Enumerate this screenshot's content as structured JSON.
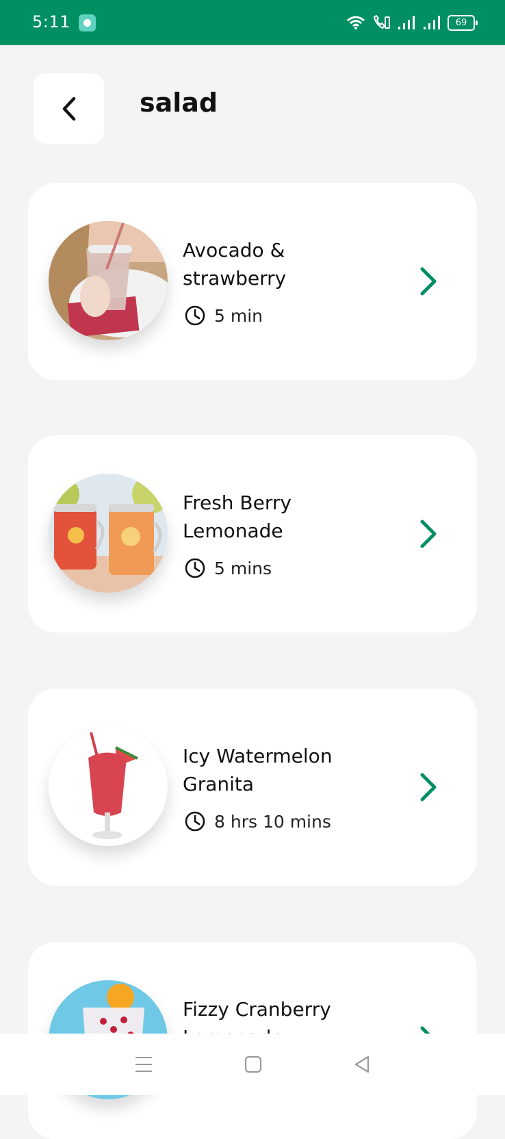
{
  "status_bar": {
    "time": "5:11",
    "battery": "69",
    "icons": [
      "app-notification-icon",
      "wifi-icon",
      "wifi-calling-icon",
      "signal-icon",
      "signal-icon",
      "battery-icon"
    ]
  },
  "header": {
    "back_icon": "chevron-left-icon",
    "title": "salad"
  },
  "recipes": [
    {
      "name": "Avocado & strawberry",
      "time": "5 min",
      "image": "smoothie-cup-photo"
    },
    {
      "name": "Fresh Berry Lemonade",
      "time": "5 mins",
      "image": "lemonade-jars-photo"
    },
    {
      "name": "Icy Watermelon Granita",
      "time": "8 hrs 10 mins",
      "image": "watermelon-granita-photo"
    },
    {
      "name": "Fizzy Cranberry Lemonade",
      "time": "",
      "image": "cranberry-lemonade-photo"
    }
  ],
  "colors": {
    "accent": "#008f63",
    "background": "#f4f4f4",
    "card": "#ffffff"
  },
  "nav_bar": {
    "icons": [
      "menu-icon",
      "home-icon",
      "back-triangle-icon"
    ]
  }
}
